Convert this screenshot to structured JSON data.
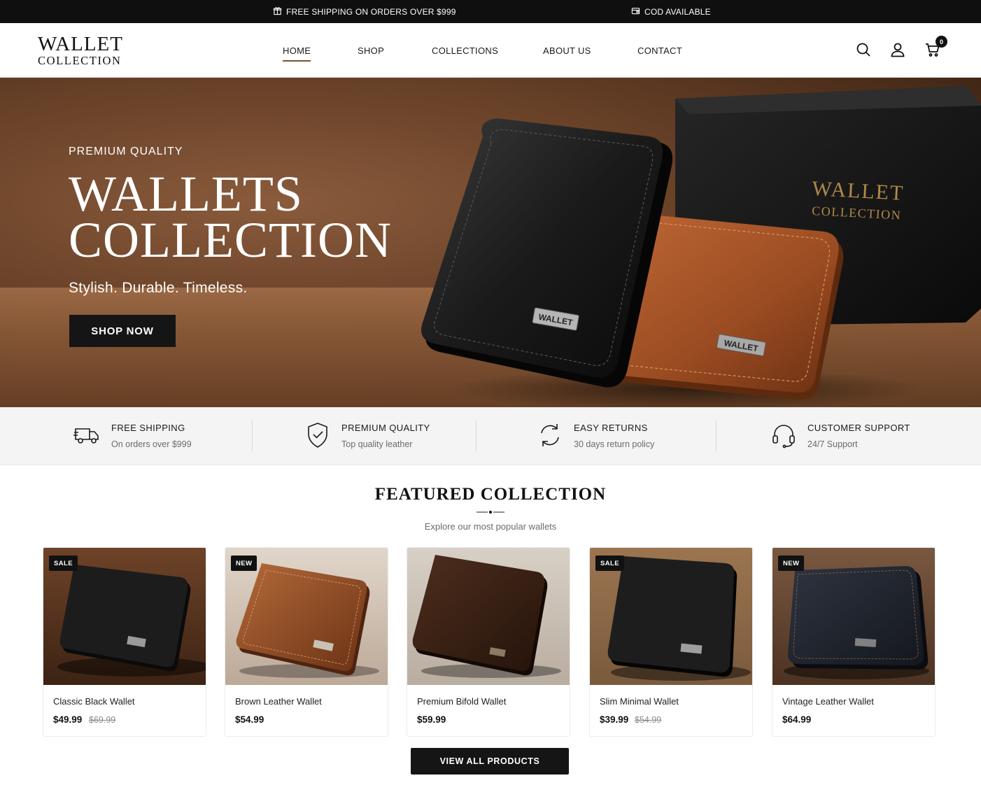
{
  "announcement": {
    "shipping_text": "FREE SHIPPING ON ORDERS OVER $999",
    "cod_text": "COD AVAILABLE"
  },
  "header": {
    "logo_line1": "WALLET",
    "logo_line2": "COLLECTION",
    "nav": [
      "HOME",
      "SHOP",
      "COLLECTIONS",
      "ABOUT US",
      "CONTACT"
    ],
    "active_nav": "HOME",
    "cart_count": "0",
    "icons": [
      "search-icon",
      "user-icon",
      "cart-icon"
    ]
  },
  "hero": {
    "eyebrow": "PREMIUM QUALITY",
    "title_line1": "WALLETS",
    "title_line2": "COLLECTION",
    "subtitle": "Stylish. Durable. Timeless.",
    "cta": "SHOP NOW",
    "box_print_line1": "WALLET",
    "box_print_line2": "COLLECTION",
    "tag_text": "WALLET"
  },
  "features": [
    {
      "icon": "truck-icon",
      "title": "FREE SHIPPING",
      "subtitle": "On orders over $999"
    },
    {
      "icon": "shield-check-icon",
      "title": "PREMIUM QUALITY",
      "subtitle": "Top quality leather"
    },
    {
      "icon": "refresh-icon",
      "title": "EASY RETURNS",
      "subtitle": "30 days return policy"
    },
    {
      "icon": "headset-icon",
      "title": "CUSTOMER SUPPORT",
      "subtitle": "24/7 Support"
    }
  ],
  "featured": {
    "title": "FEATURED COLLECTION",
    "subtitle": "Explore our most popular wallets",
    "view_all": "VIEW ALL PRODUCTS",
    "products": [
      {
        "badge": "SALE",
        "name": "Classic Black Wallet",
        "price": "$49.99",
        "old_price": "$69.99"
      },
      {
        "badge": "NEW",
        "name": "Brown Leather Wallet",
        "price": "$54.99",
        "old_price": ""
      },
      {
        "badge": "",
        "name": "Premium Bifold Wallet",
        "price": "$59.99",
        "old_price": ""
      },
      {
        "badge": "SALE",
        "name": "Slim Minimal Wallet",
        "price": "$39.99",
        "old_price": "$54.99"
      },
      {
        "badge": "NEW",
        "name": "Vintage Leather Wallet",
        "price": "$64.99",
        "old_price": ""
      }
    ]
  },
  "colors": {
    "accent_brown": "#7a5233",
    "dark": "#151515",
    "announcement_bg": "#0f0f0f",
    "features_bg": "#f4f4f4"
  }
}
